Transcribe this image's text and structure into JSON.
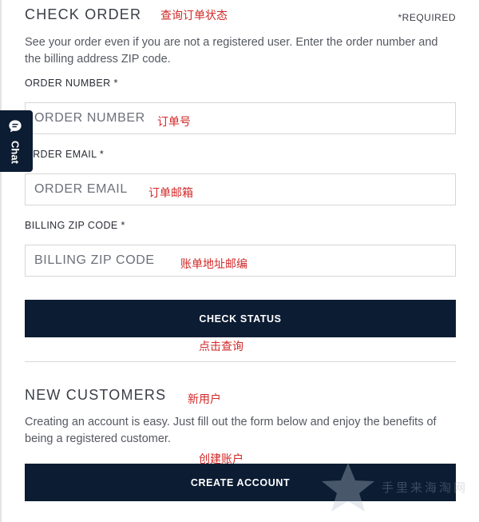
{
  "check_order": {
    "title": "CHECK ORDER",
    "title_annotation": "查询订单状态",
    "required_note": "*REQUIRED",
    "intro": "See your order even if you are not a registered user. Enter the order number and the billing address ZIP code.",
    "fields": [
      {
        "label": "ORDER NUMBER *",
        "placeholder": "ORDER NUMBER",
        "value": "",
        "annotation": "订单号"
      },
      {
        "label": "ORDER EMAIL *",
        "placeholder": "ORDER EMAIL",
        "value": "",
        "annotation": "订单邮箱"
      },
      {
        "label": "BILLING ZIP CODE *",
        "placeholder": "BILLING ZIP CODE",
        "value": "",
        "annotation": "账单地址邮编"
      }
    ],
    "button_label": "CHECK STATUS",
    "button_annotation": "点击查询"
  },
  "new_customers": {
    "title": "NEW CUSTOMERS",
    "title_annotation": "新用户",
    "intro": "Creating an account is easy. Just fill out the form below and enjoy the benefits of being a registered customer.",
    "button_annotation": "创建账户",
    "button_label": "CREATE ACCOUNT"
  },
  "chat_tab": {
    "label": "Chat",
    "icon": "chat-bubble-icon"
  },
  "watermark": {
    "text": "手里来海淘网",
    "icon": "star-icon"
  },
  "colors": {
    "button_bg": "#0b1c33",
    "annotation_red": "#d22828",
    "text": "#2a2d35",
    "muted_text": "#555861",
    "border": "#d6d6d6"
  }
}
